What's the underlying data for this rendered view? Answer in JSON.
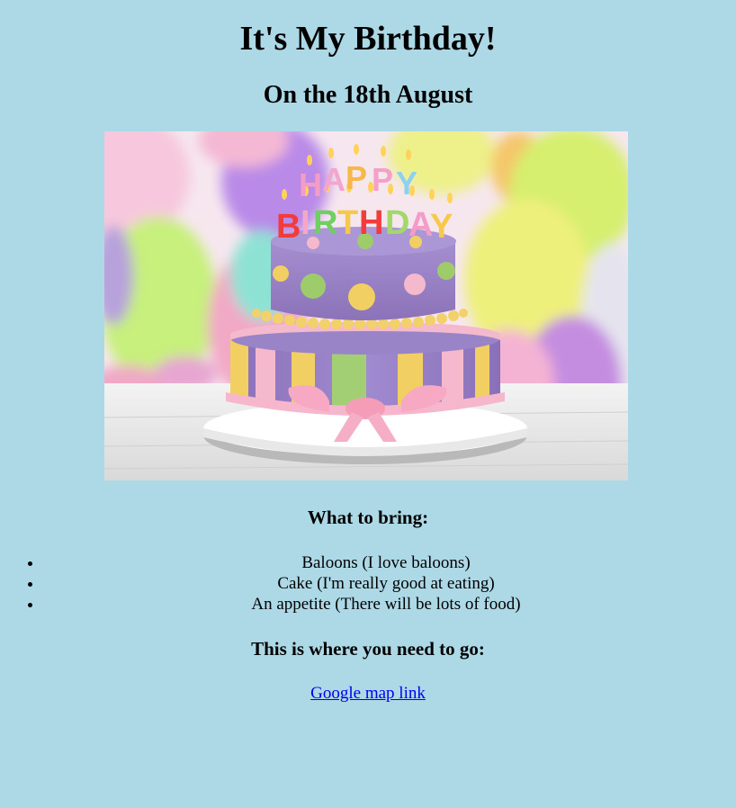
{
  "header": {
    "title": "It's My Birthday!",
    "date": "On the 18th August"
  },
  "hero": {
    "cake_topper": "HAPPY BIRTHDAY",
    "colors": {
      "background": "#add8e6",
      "cake_purple": "#9b82c4",
      "stripe_yellow": "#f2cf63",
      "stripe_green": "#a3cf74",
      "stripe_pink": "#f4b9cc"
    }
  },
  "bring": {
    "title": "What to bring:",
    "items": [
      "Baloons (I love baloons)",
      "Cake (I'm really good at eating)",
      "An appetite (There will be lots of food)"
    ]
  },
  "location": {
    "title": "This is where you need to go:",
    "link_text": "Google map link"
  }
}
